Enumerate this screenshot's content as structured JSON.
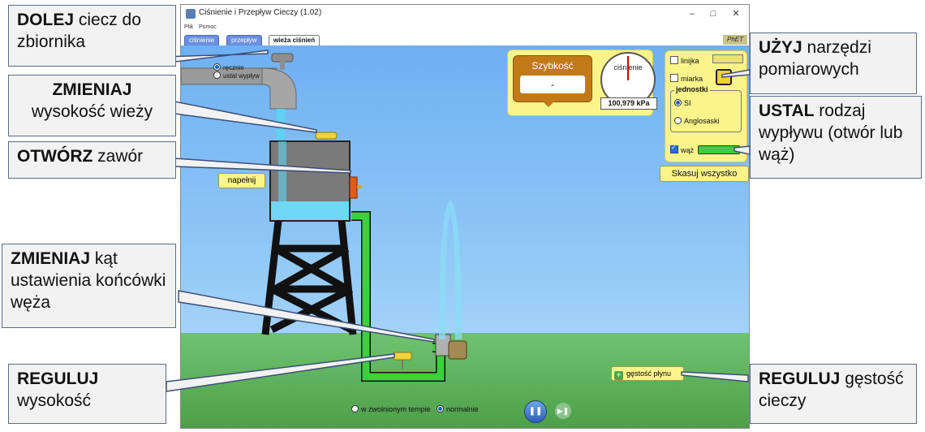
{
  "window": {
    "title": "Ciśnienie i Przepływ Cieczy (1.02)",
    "minimize": "–",
    "maximize": "□",
    "close": "✕"
  },
  "menubar": {
    "file": "Plik",
    "help": "Pomoc"
  },
  "tabs": [
    {
      "label": "ciśnienie",
      "active": false
    },
    {
      "label": "przepływ",
      "active": false
    },
    {
      "label": "wieża ciśnień",
      "active": true
    }
  ],
  "logo": "PhET",
  "flow_control": {
    "manual": "ręcznie",
    "match": "ustal wypływ",
    "selected": "manual"
  },
  "speed_meter": {
    "title": "Szybkość",
    "value": "-"
  },
  "pressure_gauge": {
    "label": "ciśnienie",
    "value": "100,979 kPa"
  },
  "tools": {
    "ruler": "linijka",
    "measuring_tape": "miarka",
    "units_title": "jednostki",
    "unit_si": "SI",
    "unit_english": "Anglosaski",
    "units_selected": "SI",
    "hose": "wąż",
    "hose_checked": true
  },
  "reset_all": "Skasuj wszystko",
  "fill_button": "napełnij",
  "density_button": "gęstość płynu",
  "playback": {
    "slow": "w zwolnionym tempie",
    "normal": "normalnie",
    "selected": "normal",
    "pause": "❚❚",
    "step": "▶❚"
  },
  "callouts": {
    "refill": {
      "bold": "DOLEJ",
      "text": " ciecz do zbiornika"
    },
    "tower_height": {
      "bold": "ZMIENIAJ",
      "text": " wysokość wieży"
    },
    "open_valve": {
      "bold": "OTWÓRZ",
      "text": " zawór"
    },
    "nozzle_angle": {
      "bold": "ZMIENIAJ",
      "text": " kąt ustawienia końcówki węża"
    },
    "nozzle_height": {
      "bold": "REGULUJ",
      "text": " wysokość"
    },
    "tools": {
      "bold": "UŻYJ",
      "text": " narzędzi pomiarowych"
    },
    "outflow": {
      "bold": "USTAL",
      "text": " rodzaj wypływu (otwór lub wąż)"
    },
    "density": {
      "bold": "REGULUJ",
      "text": " gęstość cieczy"
    }
  },
  "colors": {
    "accent_blue": "#6b8ee0",
    "panel_yellow": "#fbf48a",
    "hose_green": "#3ecf3e",
    "water": "#5ed4f0"
  }
}
